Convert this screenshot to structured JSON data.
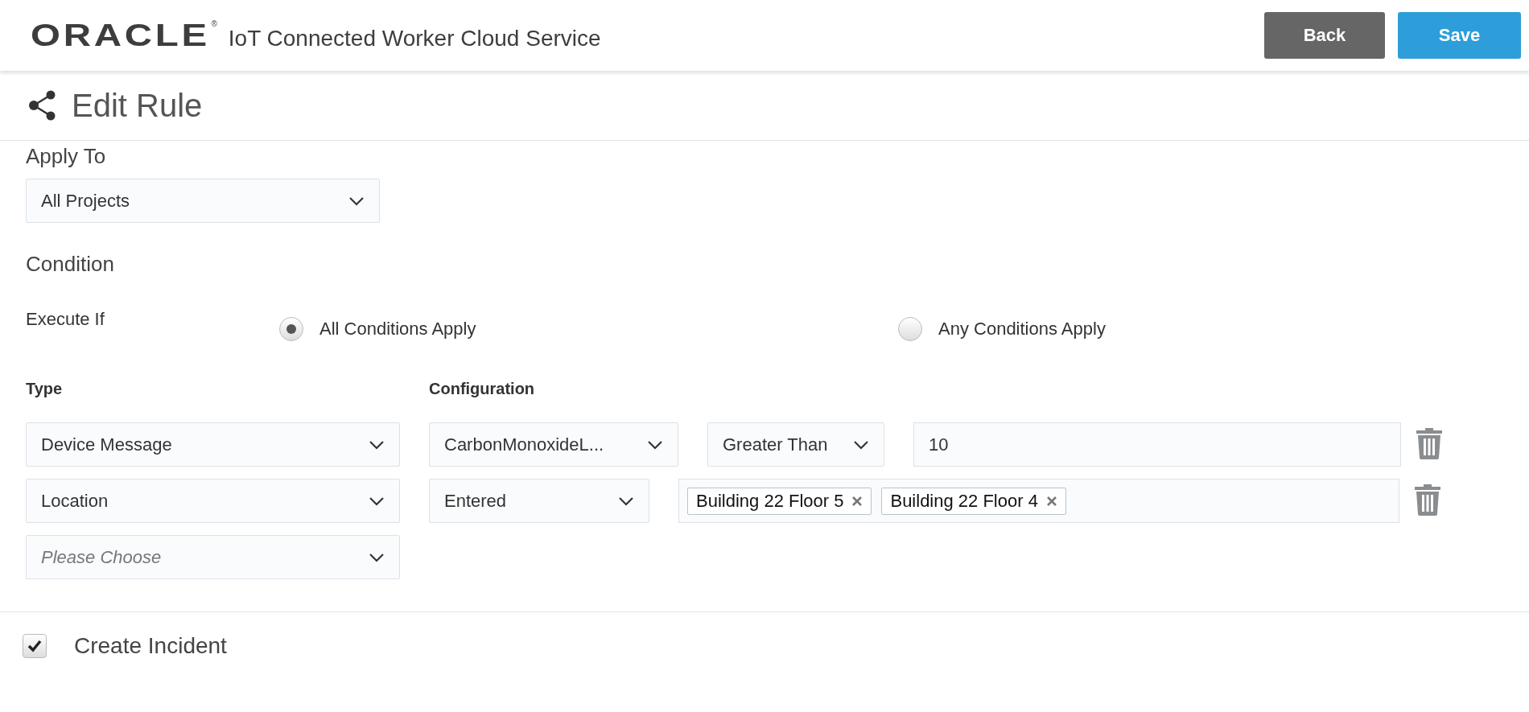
{
  "header": {
    "logo": "ORACLE",
    "logo_mark": "®",
    "product": "IoT Connected Worker Cloud Service",
    "buttons": [
      {
        "label": "Back",
        "kind": "secondary"
      },
      {
        "label": "Save",
        "kind": "primary"
      }
    ]
  },
  "page_title": "Edit Rule",
  "apply_to": {
    "heading": "Apply To",
    "value": "All Projects"
  },
  "condition": {
    "heading": "Condition",
    "execute_if": "Execute If",
    "options": [
      {
        "label": "All Conditions Apply",
        "selected": true
      },
      {
        "label": "Any Conditions Apply",
        "selected": false
      }
    ],
    "columns": [
      "Type",
      "Configuration"
    ],
    "rows": [
      {
        "type": {
          "value": "Device Message"
        },
        "fields": [
          {
            "kind": "select",
            "value": "CarbonMonoxideL..."
          },
          {
            "kind": "select",
            "value": "Greater Than"
          },
          {
            "kind": "input",
            "value": "10"
          }
        ]
      },
      {
        "type": {
          "value": "Location"
        },
        "fields": [
          {
            "kind": "select",
            "value": "Entered"
          },
          {
            "kind": "tags",
            "tags": [
              "Building 22 Floor 5",
              "Building 22 Floor 4"
            ]
          }
        ]
      },
      {
        "type": {
          "placeholder": "Please Choose"
        }
      }
    ]
  },
  "create_incident": {
    "label": "Create Incident",
    "checked": true
  }
}
